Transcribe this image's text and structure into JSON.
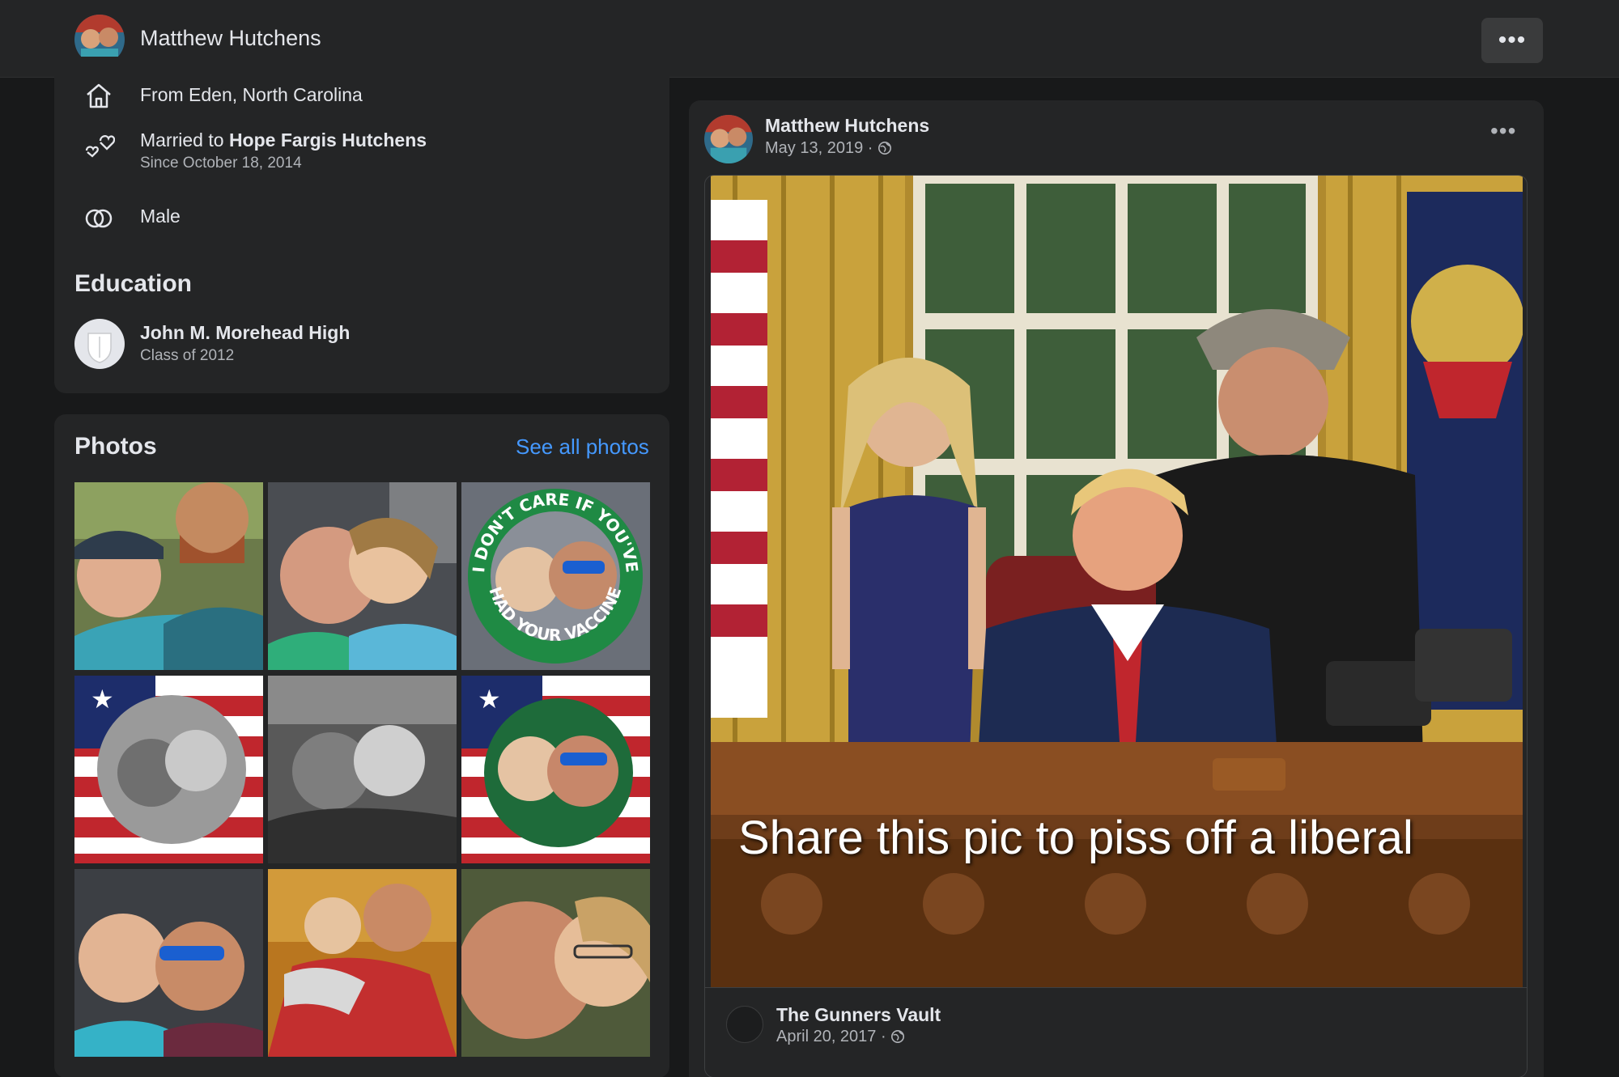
{
  "header": {
    "name": "Matthew Hutchens",
    "more_label": "•••"
  },
  "intro": {
    "hometown": "From Eden, North Carolina",
    "relationship_prefix": "Married to ",
    "relationship_name": "Hope Fargis Hutchens",
    "relationship_since": "Since October 18, 2014",
    "gender": "Male"
  },
  "education": {
    "title": "Education",
    "school": "John M. Morehead High",
    "class": "Class of 2012"
  },
  "photos": {
    "title": "Photos",
    "see_all": "See all photos",
    "badge_top": "I DON'T CARE IF YOU'VE",
    "badge_bottom": "HAD YOUR VACCINE"
  },
  "post": {
    "author": "Matthew Hutchens",
    "date": "May 13, 2019 ·",
    "more_label": "•••",
    "caption": "Share this pic to piss off a liberal",
    "source_name": "The Gunners Vault",
    "source_date": "April 20, 2017 ·"
  },
  "colors": {
    "background": "#18191a",
    "card": "#242526",
    "link": "#4599ff"
  }
}
